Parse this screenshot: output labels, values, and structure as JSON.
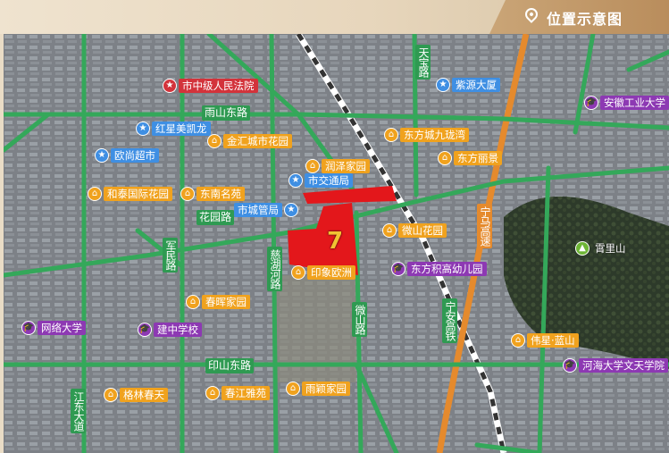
{
  "header": {
    "title": "位置示意图",
    "icon": "location-pin-icon"
  },
  "site": {
    "label": "7",
    "color": "#e3171b"
  },
  "roads": {
    "yushan_east": "雨山东路",
    "huayuan": "花园路",
    "yinshan_east": "印山东路",
    "junmin": "军民路",
    "cihuhe": "慈湖河路",
    "weishan": "微山路",
    "tianbao": "天宝路",
    "jiangdong": "江东大道",
    "ningma_expressway": "宁马高速",
    "ningan_railway": "宁安高铁"
  },
  "pois": [
    {
      "id": "court",
      "name": "市中级人民法院",
      "type": "red",
      "icon": "star-icon"
    },
    {
      "id": "ziyuan",
      "name": "紫源大厦",
      "type": "blue",
      "icon": "star-icon"
    },
    {
      "id": "anhui_univ",
      "name": "安徽工业大学",
      "type": "purple",
      "icon": "graduation-cap-icon"
    },
    {
      "id": "redstar",
      "name": "红星美凯龙",
      "type": "blue",
      "icon": "star-icon"
    },
    {
      "id": "jinhui",
      "name": "金汇城市花园",
      "type": "orange",
      "icon": "house-icon"
    },
    {
      "id": "dongfangcheng",
      "name": "东方城九珑湾",
      "type": "orange",
      "icon": "house-icon"
    },
    {
      "id": "oushang",
      "name": "欧尚超市",
      "type": "blue",
      "icon": "star-icon"
    },
    {
      "id": "runze",
      "name": "润泽家园",
      "type": "orange",
      "icon": "house-icon"
    },
    {
      "id": "dongfangliting",
      "name": "东方丽景",
      "type": "orange",
      "icon": "house-icon"
    },
    {
      "id": "traffic",
      "name": "市交通局",
      "type": "blue",
      "icon": "star-icon"
    },
    {
      "id": "hetai",
      "name": "和泰国际花园",
      "type": "orange",
      "icon": "house-icon"
    },
    {
      "id": "dongnan",
      "name": "东南名苑",
      "type": "orange",
      "icon": "house-icon"
    },
    {
      "id": "chengguan",
      "name": "市城管局",
      "type": "blue",
      "icon": "star-icon"
    },
    {
      "id": "weishan_garden",
      "name": "微山花园",
      "type": "orange",
      "icon": "house-icon"
    },
    {
      "id": "xiaolishan",
      "name": "霄里山",
      "type": "green",
      "icon": "mountain-icon"
    },
    {
      "id": "yinxiang",
      "name": "印象欧洲",
      "type": "orange",
      "icon": "house-icon"
    },
    {
      "id": "kindergarten",
      "name": "东方积高幼儿园",
      "type": "purple",
      "icon": "graduation-cap-icon"
    },
    {
      "id": "chunhui",
      "name": "春晖家园",
      "type": "orange",
      "icon": "house-icon"
    },
    {
      "id": "wangluo",
      "name": "网络大学",
      "type": "purple",
      "icon": "graduation-cap-icon"
    },
    {
      "id": "jianzhong",
      "name": "建中学校",
      "type": "purple",
      "icon": "graduation-cap-icon"
    },
    {
      "id": "weilan",
      "name": "伟星·蓝山",
      "type": "orange",
      "icon": "house-icon"
    },
    {
      "id": "hohai",
      "name": "河海大学文天学院",
      "type": "purple",
      "icon": "graduation-cap-icon"
    },
    {
      "id": "gelin",
      "name": "格林春天",
      "type": "orange",
      "icon": "house-icon"
    },
    {
      "id": "chunjiang",
      "name": "春江雅苑",
      "type": "orange",
      "icon": "house-icon"
    },
    {
      "id": "yuying",
      "name": "雨颖家园",
      "type": "orange",
      "icon": "house-icon"
    }
  ]
}
